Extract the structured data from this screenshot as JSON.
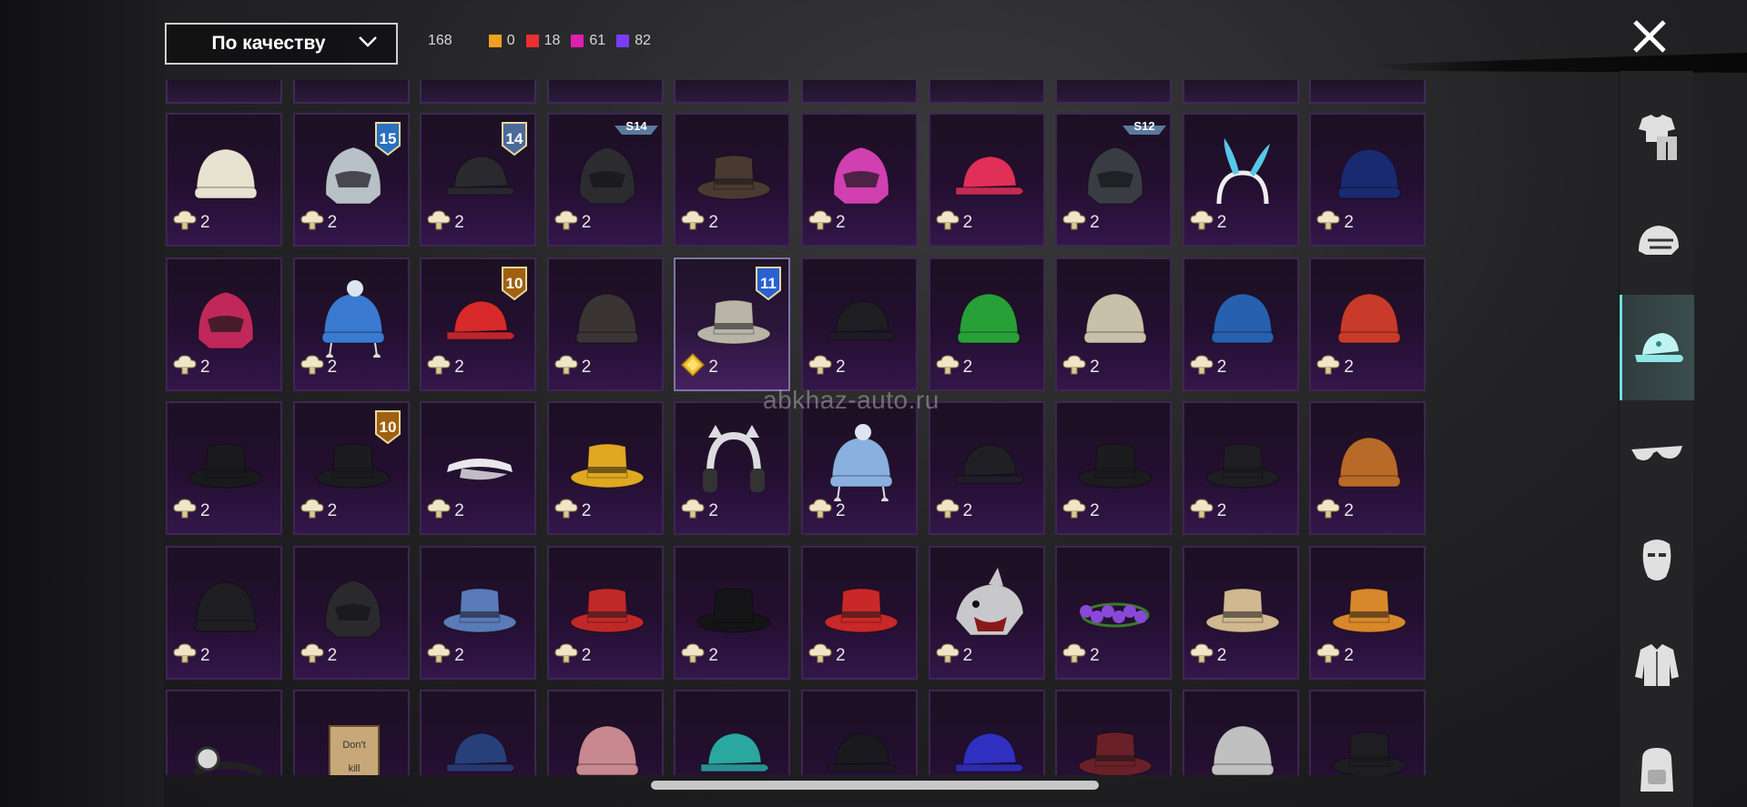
{
  "sort": {
    "label": "По качеству"
  },
  "counts": {
    "total": "168",
    "qualities": [
      {
        "color": "#f0a020",
        "value": "0"
      },
      {
        "color": "#e83030",
        "value": "18"
      },
      {
        "color": "#e020b0",
        "value": "61"
      },
      {
        "color": "#7a3cff",
        "value": "82"
      }
    ]
  },
  "watermark": "abkhaz-auto.ru",
  "sidebar": {
    "items": [
      {
        "name": "outfit",
        "icon": "outfit-icon",
        "active": false
      },
      {
        "name": "helmet",
        "icon": "helmet-icon",
        "active": false
      },
      {
        "name": "hat",
        "icon": "cap-icon",
        "active": true
      },
      {
        "name": "glasses",
        "icon": "glasses-icon",
        "active": false
      },
      {
        "name": "mask",
        "icon": "mask-icon",
        "active": false
      },
      {
        "name": "jacket",
        "icon": "jacket-icon",
        "active": false
      },
      {
        "name": "backpack",
        "icon": "backpack-icon",
        "active": false
      }
    ]
  },
  "items": [
    {
      "icon": "turban-plume-icon",
      "cost": "2",
      "currency": "cloud",
      "badge": "",
      "color": "#e8e2d0"
    },
    {
      "icon": "knight-helmet-icon",
      "cost": "2",
      "currency": "cloud",
      "badge": "15",
      "color": "#b8c0c8"
    },
    {
      "icon": "police-cap-icon",
      "cost": "2",
      "currency": "cloud",
      "badge": "14",
      "color": "#2a2a2e"
    },
    {
      "icon": "spartan-helmet-icon",
      "cost": "2",
      "currency": "cloud",
      "badge": "S14",
      "color": "#2c2c30"
    },
    {
      "icon": "top-hat-goggles-icon",
      "cost": "2",
      "currency": "cloud",
      "badge": "",
      "color": "#4a3a32"
    },
    {
      "icon": "spiked-helmet-icon",
      "cost": "2",
      "currency": "cloud",
      "badge": "",
      "color": "#d040b0"
    },
    {
      "icon": "pink-cap-icon",
      "cost": "2",
      "currency": "cloud",
      "badge": "",
      "color": "#e0305a"
    },
    {
      "icon": "gas-mask-helmet-icon",
      "cost": "2",
      "currency": "cloud",
      "badge": "S12",
      "color": "#3a3c44"
    },
    {
      "icon": "bunny-ears-icon",
      "cost": "2",
      "currency": "cloud",
      "badge": "",
      "color": "#58c8e8"
    },
    {
      "icon": "blue-beanie-icon",
      "cost": "2",
      "currency": "cloud",
      "badge": "",
      "color": "#1a2a70"
    },
    {
      "icon": "moto-helmet-icon",
      "cost": "2",
      "currency": "cloud",
      "badge": "",
      "color": "#c0285a"
    },
    {
      "icon": "pom-beanie-icon",
      "cost": "2",
      "currency": "cloud",
      "badge": "",
      "color": "#3a7ad0"
    },
    {
      "icon": "red-cap-icon",
      "cost": "2",
      "currency": "cloud",
      "badge": "10",
      "color": "#d82a2a"
    },
    {
      "icon": "beanie-pattern-icon",
      "cost": "2",
      "currency": "cloud",
      "badge": "",
      "color": "#3a3434"
    },
    {
      "icon": "bucket-hat-icon",
      "cost": "2",
      "currency": "diamond",
      "badge": "11",
      "color": "#b8b4a8"
    },
    {
      "icon": "black-cap-icon",
      "cost": "2",
      "currency": "cloud",
      "badge": "",
      "color": "#1e1e22"
    },
    {
      "icon": "green-beanie-icon",
      "cost": "2",
      "currency": "cloud",
      "badge": "",
      "color": "#28a038"
    },
    {
      "icon": "turban-icon",
      "cost": "2",
      "currency": "cloud",
      "badge": "",
      "color": "#c8c0a8"
    },
    {
      "icon": "blue-turban-icon",
      "cost": "2",
      "currency": "cloud",
      "badge": "",
      "color": "#2860b0"
    },
    {
      "icon": "skull-bandana-icon",
      "cost": "2",
      "currency": "cloud",
      "badge": "",
      "color": "#c83a2a"
    },
    {
      "icon": "pirate-hat-icon",
      "cost": "2",
      "currency": "cloud",
      "badge": "",
      "color": "#1a1a1c"
    },
    {
      "icon": "fedora-icon",
      "cost": "2",
      "currency": "cloud",
      "badge": "10",
      "color": "#1c1c20"
    },
    {
      "icon": "visor-icon",
      "cost": "2",
      "currency": "cloud",
      "badge": "",
      "color": "#e8e8ec"
    },
    {
      "icon": "yellow-bucket-icon",
      "cost": "2",
      "currency": "cloud",
      "badge": "",
      "color": "#e0a820"
    },
    {
      "icon": "cat-headphones-icon",
      "cost": "2",
      "currency": "cloud",
      "badge": "",
      "color": "#dcdce0"
    },
    {
      "icon": "goggle-beanie-icon",
      "cost": "2",
      "currency": "cloud",
      "badge": "",
      "color": "#8ab0e0"
    },
    {
      "icon": "black-cap-2-icon",
      "cost": "2",
      "currency": "cloud",
      "badge": "",
      "color": "#202024"
    },
    {
      "icon": "beret-icon",
      "cost": "2",
      "currency": "cloud",
      "badge": "",
      "color": "#1c1c1e"
    },
    {
      "icon": "short-top-hat-icon",
      "cost": "2",
      "currency": "cloud",
      "badge": "",
      "color": "#1e1e22"
    },
    {
      "icon": "brown-beanie-icon",
      "cost": "2",
      "currency": "cloud",
      "badge": "",
      "color": "#b86a28"
    },
    {
      "icon": "black-beanie-icon",
      "cost": "2",
      "currency": "cloud",
      "badge": "",
      "color": "#1e1e22"
    },
    {
      "icon": "wrestler-mask-icon",
      "cost": "2",
      "currency": "cloud",
      "badge": "",
      "color": "#2a2a2e"
    },
    {
      "icon": "shark-hat-icon",
      "cost": "2",
      "currency": "cloud",
      "badge": "",
      "color": "#5a7ab8"
    },
    {
      "icon": "red-beret-icon",
      "cost": "2",
      "currency": "cloud",
      "badge": "",
      "color": "#c02828"
    },
    {
      "icon": "black-top-hat-icon",
      "cost": "2",
      "currency": "cloud",
      "badge": "",
      "color": "#141416"
    },
    {
      "icon": "red-fedora-icon",
      "cost": "2",
      "currency": "cloud",
      "badge": "",
      "color": "#c82828"
    },
    {
      "icon": "white-shark-icon",
      "cost": "2",
      "currency": "cloud",
      "badge": "",
      "color": "#c8c8cc"
    },
    {
      "icon": "flower-crown-icon",
      "cost": "2",
      "currency": "cloud",
      "badge": "",
      "color": "#8a48d8"
    },
    {
      "icon": "cake-hat-icon",
      "cost": "2",
      "currency": "cloud",
      "badge": "",
      "color": "#d0b890"
    },
    {
      "icon": "burger-hat-icon",
      "cost": "2",
      "currency": "cloud",
      "badge": "",
      "color": "#d8882a"
    },
    {
      "icon": "headlamp-icon",
      "cost": "",
      "currency": "",
      "badge": "",
      "color": "#d8d8d8"
    },
    {
      "icon": "cardboard-box-icon",
      "cost": "",
      "currency": "",
      "badge": "",
      "color": "#c8a878",
      "text": "Don't kill"
    },
    {
      "icon": "blue-cap-icon",
      "cost": "",
      "currency": "",
      "badge": "",
      "color": "#28407a"
    },
    {
      "icon": "pink-beanie-icon",
      "cost": "",
      "currency": "",
      "badge": "",
      "color": "#c88890"
    },
    {
      "icon": "teal-cap-icon",
      "cost": "",
      "currency": "",
      "badge": "",
      "color": "#2aa8a0"
    },
    {
      "icon": "black-cap-text-icon",
      "cost": "",
      "currency": "",
      "badge": "",
      "color": "#1a1a1e"
    },
    {
      "icon": "purple-cap-icon",
      "cost": "",
      "currency": "",
      "badge": "",
      "color": "#3030c0"
    },
    {
      "icon": "maroon-fedora-icon",
      "cost": "",
      "currency": "",
      "badge": "",
      "color": "#6a2028"
    },
    {
      "icon": "patterned-beanie-icon",
      "cost": "",
      "currency": "",
      "badge": "",
      "color": "#c0c0c0"
    },
    {
      "icon": "black-bucket-icon",
      "cost": "",
      "currency": "",
      "badge": "",
      "color": "#1e1e22"
    }
  ]
}
